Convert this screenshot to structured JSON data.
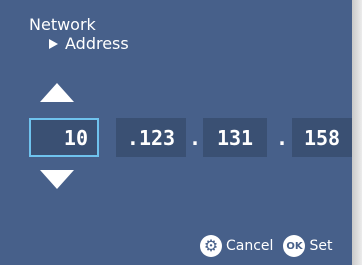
{
  "header": {
    "title": "Network",
    "subtitle": "Address"
  },
  "address": {
    "octets": [
      "10",
      ".123",
      "131",
      "158"
    ],
    "separators": [
      ".",
      "."
    ],
    "selected_index": 0
  },
  "footer": {
    "cancel_label": "Cancel",
    "set_label": "Set",
    "ok_badge": "OK"
  },
  "icons": {
    "up": "triangle-up-icon",
    "down": "triangle-down-icon",
    "cancel": "gear-icon",
    "set": "ok-icon",
    "breadcrumb": "play-icon"
  },
  "colors": {
    "background": "#47608a",
    "field": "#3a5073",
    "selection": "#6fc3ee",
    "text": "#ffffff"
  }
}
